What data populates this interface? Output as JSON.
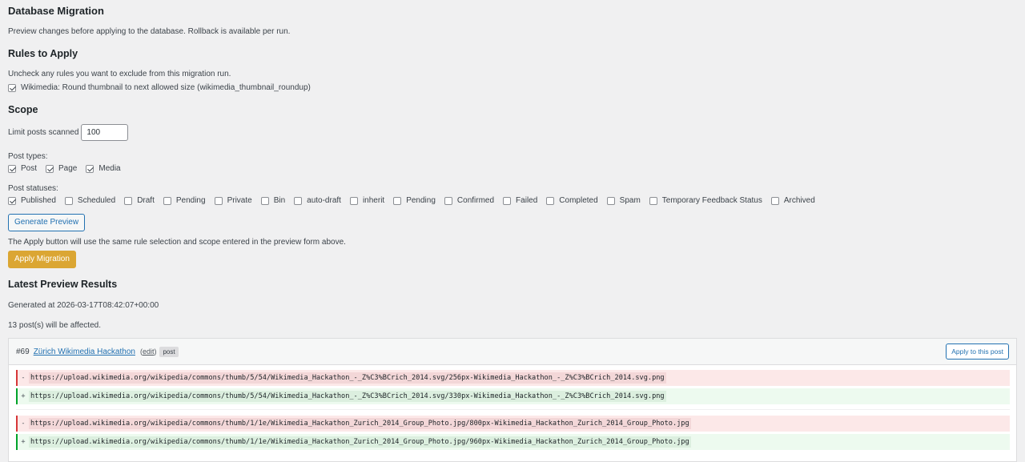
{
  "page": {
    "title": "Database Migration",
    "description": "Preview changes before applying to the database. Rollback is available per run."
  },
  "rules": {
    "heading": "Rules to Apply",
    "description": "Uncheck any rules you want to exclude from this migration run.",
    "items": [
      {
        "label": "Wikimedia: Round thumbnail to next allowed size (wikimedia_thumbnail_roundup)",
        "checked": true
      }
    ]
  },
  "scope": {
    "heading": "Scope",
    "limit_label": "Limit posts scanned",
    "limit_value": "100",
    "post_types_label": "Post types:",
    "post_types": [
      {
        "label": "Post",
        "checked": true
      },
      {
        "label": "Page",
        "checked": true
      },
      {
        "label": "Media",
        "checked": true
      }
    ],
    "post_statuses_label": "Post statuses:",
    "post_statuses": [
      {
        "label": "Published",
        "checked": true
      },
      {
        "label": "Scheduled",
        "checked": false
      },
      {
        "label": "Draft",
        "checked": false
      },
      {
        "label": "Pending",
        "checked": false
      },
      {
        "label": "Private",
        "checked": false
      },
      {
        "label": "Bin",
        "checked": false
      },
      {
        "label": "auto-draft",
        "checked": false
      },
      {
        "label": "inherit",
        "checked": false
      },
      {
        "label": "Pending",
        "checked": false
      },
      {
        "label": "Confirmed",
        "checked": false
      },
      {
        "label": "Failed",
        "checked": false
      },
      {
        "label": "Completed",
        "checked": false
      },
      {
        "label": "Spam",
        "checked": false
      },
      {
        "label": "Temporary Feedback Status",
        "checked": false
      },
      {
        "label": "Archived",
        "checked": false
      }
    ]
  },
  "actions": {
    "generate_preview": "Generate Preview",
    "apply_note": "The Apply button will use the same rule selection and scope entered in the preview form above.",
    "apply_migration": "Apply Migration"
  },
  "results": {
    "heading": "Latest Preview Results",
    "generated_at": "Generated at 2026-03-17T08:42:07+00:00",
    "affected": "13 post(s) will be affected.",
    "post": {
      "id": "#69",
      "title": "Zürich Wikimedia Hackathon",
      "edit_label": "edit",
      "type": "post",
      "apply_label": "Apply to this post",
      "diffs": [
        {
          "sign": "-",
          "kind": "del",
          "text": "https://upload.wikimedia.org/wikipedia/commons/thumb/5/54/Wikimedia_Hackathon_-_Z%C3%BCrich_2014.svg/256px-Wikimedia_Hackathon_-_Z%C3%BCrich_2014.svg.png"
        },
        {
          "sign": "+",
          "kind": "add",
          "text": "https://upload.wikimedia.org/wikipedia/commons/thumb/5/54/Wikimedia_Hackathon_-_Z%C3%BCrich_2014.svg/330px-Wikimedia_Hackathon_-_Z%C3%BCrich_2014.svg.png"
        },
        {
          "sign": "-",
          "kind": "del",
          "text": "https://upload.wikimedia.org/wikipedia/commons/thumb/1/1e/Wikimedia_Hackathon_Zurich_2014_Group_Photo.jpg/800px-Wikimedia_Hackathon_Zurich_2014_Group_Photo.jpg"
        },
        {
          "sign": "+",
          "kind": "add",
          "text": "https://upload.wikimedia.org/wikipedia/commons/thumb/1/1e/Wikimedia_Hackathon_Zurich_2014_Group_Photo.jpg/960px-Wikimedia_Hackathon_Zurich_2014_Group_Photo.jpg"
        }
      ]
    }
  }
}
